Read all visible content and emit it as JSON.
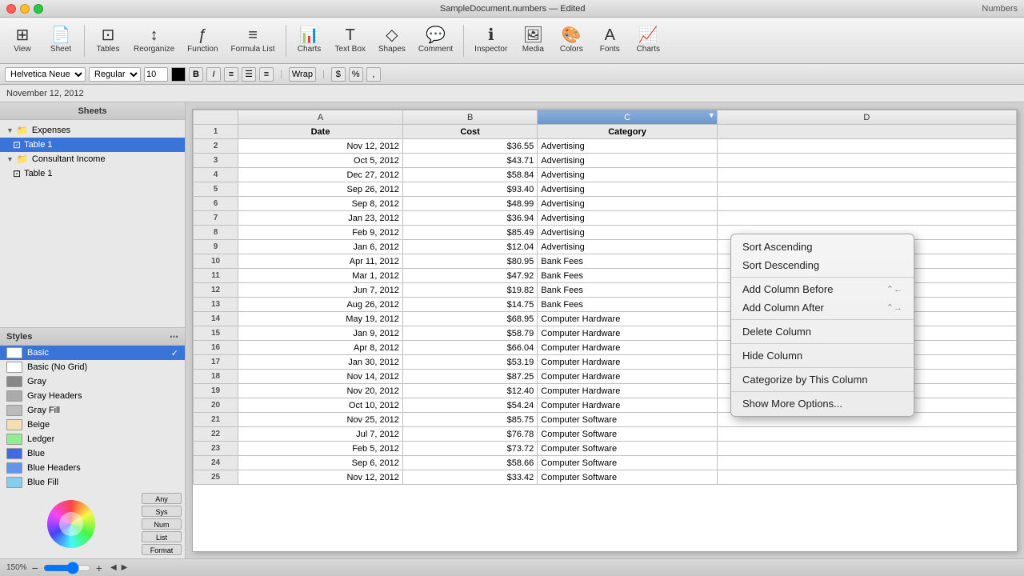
{
  "titleBar": {
    "trafficLights": [
      "close",
      "minimize",
      "maximize"
    ],
    "title": "SampleDocument.numbers — Edited",
    "rightText": "Numbers"
  },
  "toolbar": {
    "buttons": [
      {
        "id": "view",
        "icon": "⊞",
        "label": "View"
      },
      {
        "id": "sheet",
        "icon": "📄",
        "label": "Sheet"
      },
      {
        "id": "tables",
        "icon": "⊡",
        "label": "Tables"
      },
      {
        "id": "reorganize",
        "icon": "↕",
        "label": "Reorganize"
      },
      {
        "id": "function",
        "icon": "ƒ",
        "label": "Function"
      },
      {
        "id": "formula-list",
        "icon": "≡",
        "label": "Formula List"
      },
      {
        "id": "charts",
        "icon": "📊",
        "label": "Charts"
      },
      {
        "id": "text-box",
        "icon": "T",
        "label": "Text Box"
      },
      {
        "id": "shapes",
        "icon": "◇",
        "label": "Shapes"
      },
      {
        "id": "comment",
        "icon": "💬",
        "label": "Comment"
      },
      {
        "id": "inspector",
        "icon": "ℹ",
        "label": "Inspector"
      },
      {
        "id": "media",
        "icon": "🖼",
        "label": "Media"
      },
      {
        "id": "colors",
        "icon": "🎨",
        "label": "Colors"
      },
      {
        "id": "fonts",
        "icon": "A",
        "label": "Fonts"
      },
      {
        "id": "charts2",
        "icon": "📈",
        "label": "Charts"
      }
    ]
  },
  "formatBar": {
    "fontFamily": "Helvetica Neue",
    "fontStyle": "Regular",
    "fontSize": "10",
    "colorSwatch": "#000000"
  },
  "dateBar": {
    "date": "November 12, 2012"
  },
  "sidebar": {
    "sheetsLabel": "Sheets",
    "trees": [
      {
        "id": "expenses",
        "label": "Expenses",
        "indent": 0,
        "type": "folder",
        "expanded": true
      },
      {
        "id": "table1-exp",
        "label": "Table 1",
        "indent": 1,
        "type": "table",
        "active": true
      },
      {
        "id": "consultant",
        "label": "Consultant Income",
        "indent": 0,
        "type": "folder",
        "expanded": true
      },
      {
        "id": "table1-con",
        "label": "Table 1",
        "indent": 1,
        "type": "table"
      }
    ],
    "stylesLabel": "Styles",
    "styles": [
      {
        "id": "basic",
        "label": "Basic",
        "color": "#ffffff",
        "active": true
      },
      {
        "id": "basic-no-grid",
        "label": "Basic (No Grid)",
        "color": "#ffffff"
      },
      {
        "id": "gray",
        "label": "Gray",
        "color": "#888888"
      },
      {
        "id": "gray-headers",
        "label": "Gray Headers",
        "color": "#aaaaaa"
      },
      {
        "id": "gray-fill",
        "label": "Gray Fill",
        "color": "#bbbbbb"
      },
      {
        "id": "beige",
        "label": "Beige",
        "color": "#f5deb3"
      },
      {
        "id": "ledger",
        "label": "Ledger",
        "color": "#90ee90"
      },
      {
        "id": "blue",
        "label": "Blue",
        "color": "#4169e1"
      },
      {
        "id": "blue-headers",
        "label": "Blue Headers",
        "color": "#6495ed"
      },
      {
        "id": "blue-fill",
        "label": "Blue Fill",
        "color": "#87ceeb"
      }
    ]
  },
  "spreadsheet": {
    "columns": [
      "",
      "A",
      "B",
      "C",
      "D"
    ],
    "columnLabels": [
      "Date",
      "Cost",
      "Category",
      ""
    ],
    "rows": [
      {
        "num": 2,
        "date": "Nov 12, 2012",
        "cost": "$36.55",
        "category": "Advertising"
      },
      {
        "num": 3,
        "date": "Oct 5, 2012",
        "cost": "$43.71",
        "category": "Advertising"
      },
      {
        "num": 4,
        "date": "Dec 27, 2012",
        "cost": "$58.84",
        "category": "Advertising"
      },
      {
        "num": 5,
        "date": "Sep 26, 2012",
        "cost": "$93.40",
        "category": "Advertising"
      },
      {
        "num": 6,
        "date": "Sep 8, 2012",
        "cost": "$48.99",
        "category": "Advertising"
      },
      {
        "num": 7,
        "date": "Jan 23, 2012",
        "cost": "$36.94",
        "category": "Advertising"
      },
      {
        "num": 8,
        "date": "Feb 9, 2012",
        "cost": "$85.49",
        "category": "Advertising"
      },
      {
        "num": 9,
        "date": "Jan 6, 2012",
        "cost": "$12.04",
        "category": "Advertising"
      },
      {
        "num": 10,
        "date": "Apr 11, 2012",
        "cost": "$80.95",
        "category": "Bank Fees"
      },
      {
        "num": 11,
        "date": "Mar 1, 2012",
        "cost": "$47.92",
        "category": "Bank Fees"
      },
      {
        "num": 12,
        "date": "Jun 7, 2012",
        "cost": "$19.82",
        "category": "Bank Fees"
      },
      {
        "num": 13,
        "date": "Aug 26, 2012",
        "cost": "$14.75",
        "category": "Bank Fees"
      },
      {
        "num": 14,
        "date": "May 19, 2012",
        "cost": "$68.95",
        "category": "Computer Hardware"
      },
      {
        "num": 15,
        "date": "Jan 9, 2012",
        "cost": "$58.79",
        "category": "Computer Hardware"
      },
      {
        "num": 16,
        "date": "Apr 8, 2012",
        "cost": "$66.04",
        "category": "Computer Hardware"
      },
      {
        "num": 17,
        "date": "Jan 30, 2012",
        "cost": "$53.19",
        "category": "Computer Hardware"
      },
      {
        "num": 18,
        "date": "Nov 14, 2012",
        "cost": "$87.25",
        "category": "Computer Hardware"
      },
      {
        "num": 19,
        "date": "Nov 20, 2012",
        "cost": "$12.40",
        "category": "Computer Hardware"
      },
      {
        "num": 20,
        "date": "Oct 10, 2012",
        "cost": "$54.24",
        "category": "Computer Hardware"
      },
      {
        "num": 21,
        "date": "Nov 25, 2012",
        "cost": "$85.75",
        "category": "Computer Software"
      },
      {
        "num": 22,
        "date": "Jul 7, 2012",
        "cost": "$76.78",
        "category": "Computer Software"
      },
      {
        "num": 23,
        "date": "Feb 5, 2012",
        "cost": "$73.72",
        "category": "Computer Software"
      },
      {
        "num": 24,
        "date": "Sep 6, 2012",
        "cost": "$58.66",
        "category": "Computer Software"
      },
      {
        "num": 25,
        "date": "Nov 12, 2012",
        "cost": "$33.42",
        "category": "Computer Software"
      }
    ]
  },
  "contextMenu": {
    "items": [
      {
        "id": "sort-asc",
        "label": "Sort Ascending",
        "shortcut": ""
      },
      {
        "id": "sort-desc",
        "label": "Sort Descending",
        "shortcut": ""
      },
      {
        "id": "sep1",
        "type": "separator"
      },
      {
        "id": "add-before",
        "label": "Add Column Before",
        "shortcut": "⌃←"
      },
      {
        "id": "add-after",
        "label": "Add Column After",
        "shortcut": "⌃→"
      },
      {
        "id": "sep2",
        "type": "separator"
      },
      {
        "id": "delete",
        "label": "Delete Column",
        "shortcut": ""
      },
      {
        "id": "sep3",
        "type": "separator"
      },
      {
        "id": "hide",
        "label": "Hide Column",
        "shortcut": ""
      },
      {
        "id": "sep4",
        "type": "separator"
      },
      {
        "id": "categorize",
        "label": "Categorize by This Column",
        "shortcut": ""
      },
      {
        "id": "sep5",
        "type": "separator"
      },
      {
        "id": "more",
        "label": "Show More Options...",
        "shortcut": ""
      }
    ]
  },
  "bottomBar": {
    "zoom": "150%"
  }
}
